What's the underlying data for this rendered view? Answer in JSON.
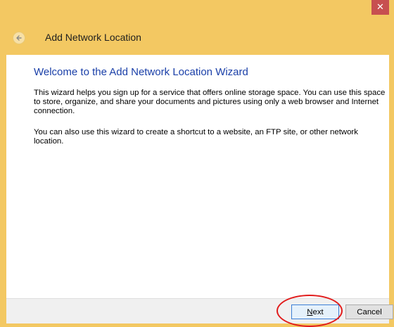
{
  "window": {
    "close_glyph": "✕",
    "accent_color": "#f3c862"
  },
  "header": {
    "title": "Add Network Location",
    "back_icon": "back-arrow-icon"
  },
  "content": {
    "heading": "Welcome to the Add Network Location Wizard",
    "paragraph1": "This wizard helps you sign up for a service that offers online storage space.  You can use this space to store, organize, and share your documents and pictures using only a web browser and Internet connection.",
    "paragraph2": "You can also use this wizard to create a shortcut to a website, an FTP site, or other network location."
  },
  "footer": {
    "next_mnemonic": "N",
    "next_rest": "ext",
    "cancel_label": "Cancel"
  },
  "annotation": {
    "color": "#e11b1b",
    "target": "next-button"
  }
}
